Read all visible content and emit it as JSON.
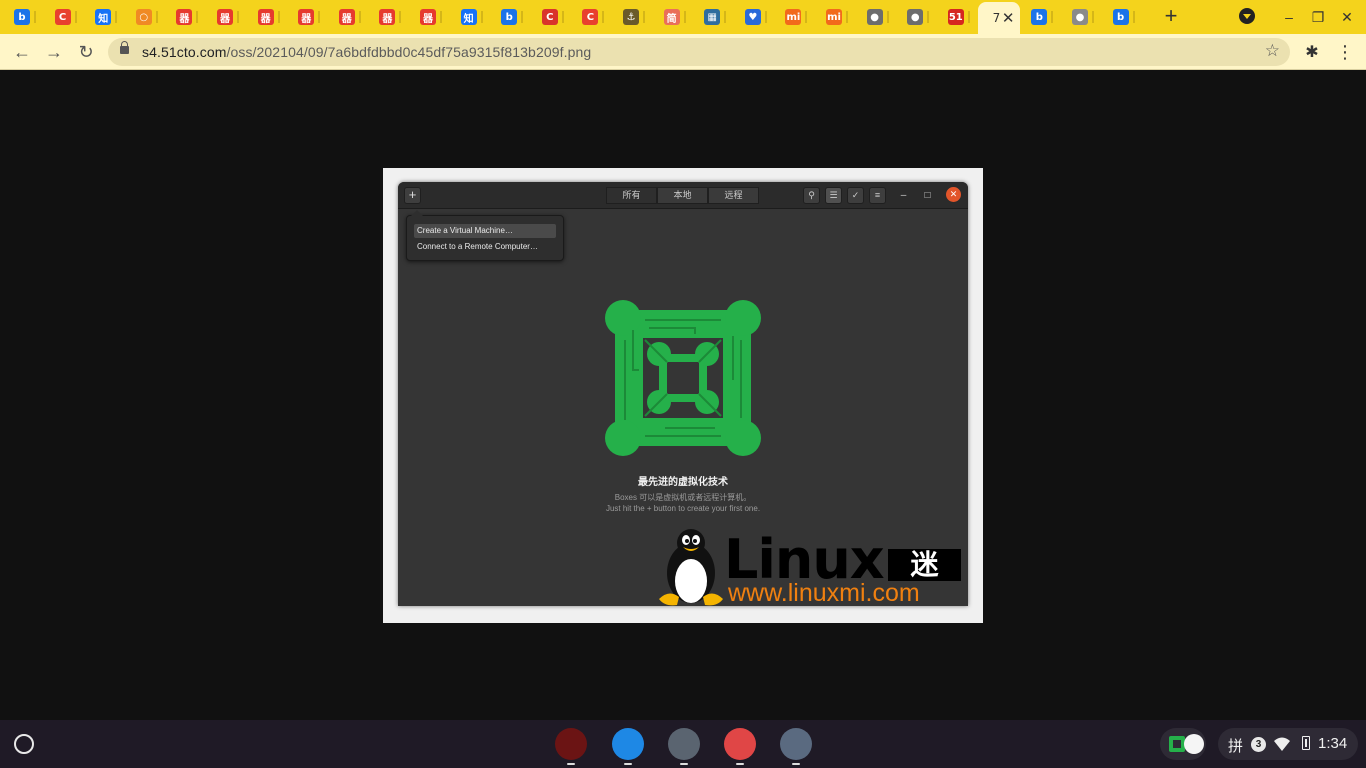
{
  "browser": {
    "tabs": [
      {
        "glyph": "b",
        "color": "#1b73e8",
        "name": "bing"
      },
      {
        "glyph": "C",
        "color": "#e8402e",
        "name": "csdn"
      },
      {
        "glyph": "知",
        "color": "#1772f6",
        "name": "zhihu"
      },
      {
        "glyph": "○",
        "color": "#f08a24",
        "name": "oval"
      },
      {
        "glyph": "器",
        "color": "#e63a2e",
        "name": "red-1"
      },
      {
        "glyph": "器",
        "color": "#e63a2e",
        "name": "red-2"
      },
      {
        "glyph": "器",
        "color": "#e63a2e",
        "name": "red-3"
      },
      {
        "glyph": "器",
        "color": "#e63a2e",
        "name": "red-4"
      },
      {
        "glyph": "器",
        "color": "#e63a2e",
        "name": "red-5"
      },
      {
        "glyph": "器",
        "color": "#e63a2e",
        "name": "red-6"
      },
      {
        "glyph": "器",
        "color": "#e63a2e",
        "name": "red-7"
      },
      {
        "glyph": "知",
        "color": "#1772f6",
        "name": "zhihu-2"
      },
      {
        "glyph": "b",
        "color": "#1b73e8",
        "name": "bing-2"
      },
      {
        "glyph": "C",
        "color": "#d9342b",
        "name": "csdn-2"
      },
      {
        "glyph": "C",
        "color": "#e8402e",
        "name": "csdn-3"
      },
      {
        "glyph": "⚓",
        "color": "#6a5a2a",
        "name": "misc"
      },
      {
        "glyph": "简",
        "color": "#ea6f5a",
        "name": "jianshu"
      },
      {
        "glyph": "▦",
        "color": "#2f6d9e",
        "name": "image"
      },
      {
        "glyph": "♥",
        "color": "#2a6ad9",
        "name": "heart"
      },
      {
        "glyph": "mi",
        "color": "#f26a1b",
        "name": "xiaomi-1"
      },
      {
        "glyph": "mi",
        "color": "#f26a1b",
        "name": "xiaomi-2"
      },
      {
        "glyph": "●",
        "color": "#6d6d6d",
        "name": "globe-1"
      },
      {
        "glyph": "●",
        "color": "#6d6d6d",
        "name": "globe-2"
      },
      {
        "glyph": "51",
        "color": "#d6261f",
        "name": "51cto"
      },
      {
        "glyph": "7",
        "color": "#ffffff",
        "name": "active",
        "active": true
      },
      {
        "glyph": "b",
        "color": "#1b73e8",
        "name": "bing-3"
      },
      {
        "glyph": "●",
        "color": "#8a8a8a",
        "name": "globe-3"
      },
      {
        "glyph": "b",
        "color": "#1b73e8",
        "name": "bing-4"
      }
    ],
    "new_tab": "+",
    "url_host": "s4.51cto.com",
    "url_path": "/oss/202104/09/7a6bdfdbbd0c45df75a9315f813b209f.png",
    "colors": {
      "accent": "#f4d31c",
      "toolbar": "#fff6c8"
    }
  },
  "boxes": {
    "new_button": "+",
    "tabs": [
      "所有",
      "本地",
      "远程"
    ],
    "popover": [
      "Create a Virtual Machine…",
      "Connect to a Remote Computer…"
    ],
    "title": "最先进的虚拟化技术",
    "subtitle1": "Boxes 可以是虚拟机或者远程计算机。",
    "subtitle2": "Just hit the + button to create your first one.",
    "tools": [
      "search-icon",
      "list-view-icon",
      "select-icon",
      "menu-icon"
    ]
  },
  "watermark": {
    "brand": "Linux",
    "brand_cn": "迷",
    "url": "www.linuxmi.com"
  },
  "shelf": {
    "apps": [
      {
        "name": "chrome",
        "color": "#6b1414"
      },
      {
        "name": "files",
        "color": "#1e88e5"
      },
      {
        "name": "terminal",
        "color": "#5a6470"
      },
      {
        "name": "text",
        "color": "#e04646"
      },
      {
        "name": "settings",
        "color": "#5a6a80"
      }
    ],
    "ime": "拼",
    "notifications": "3",
    "time": "1:34"
  }
}
